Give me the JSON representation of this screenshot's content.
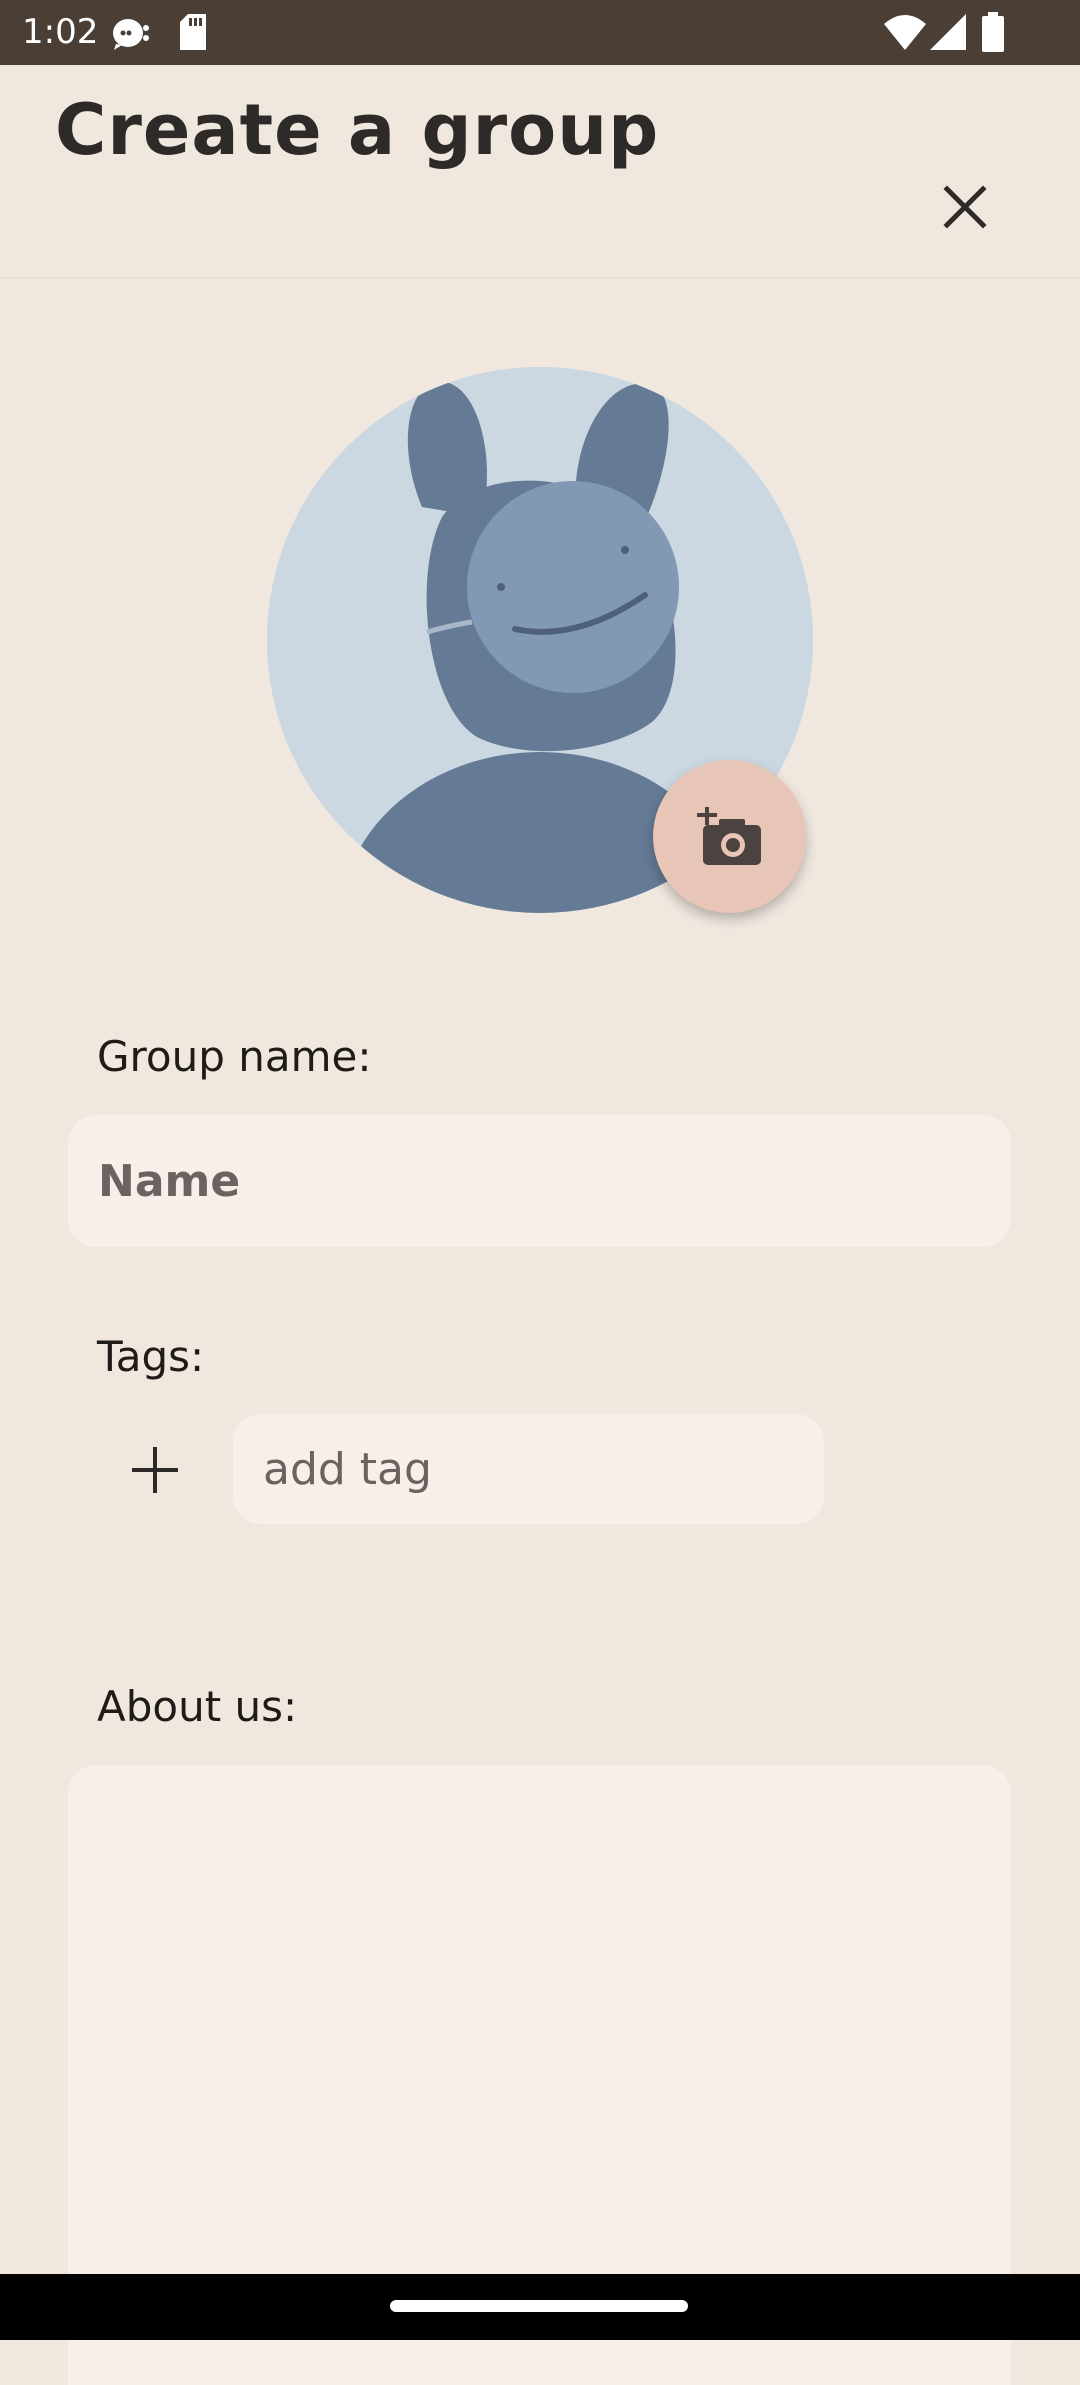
{
  "status_bar": {
    "time": "1:02",
    "icons": [
      "chat-notification-icon",
      "sd-card-icon",
      "wifi-icon",
      "cellular-signal-icon",
      "battery-icon"
    ]
  },
  "header": {
    "title": "Create a group",
    "close_icon": "close-icon"
  },
  "avatar": {
    "image": "default-group-avatar-bunny",
    "camera_icon": "add-photo-camera-icon"
  },
  "form": {
    "group_name_label": "Group name:",
    "name_placeholder": "Name",
    "name_value": "",
    "tags_label": "Tags:",
    "add_tag_icon": "plus-icon",
    "tag_placeholder": "add tag",
    "tag_value": "",
    "about_label": "About us:",
    "about_value": ""
  },
  "colors": {
    "background": "#f0e8df",
    "status_bar": "#4b3f35",
    "field_background": "#f7efe9",
    "fab_background": "#e7c6b7",
    "avatar_background": "#cbd7e1",
    "avatar_figure": "#657b95"
  }
}
